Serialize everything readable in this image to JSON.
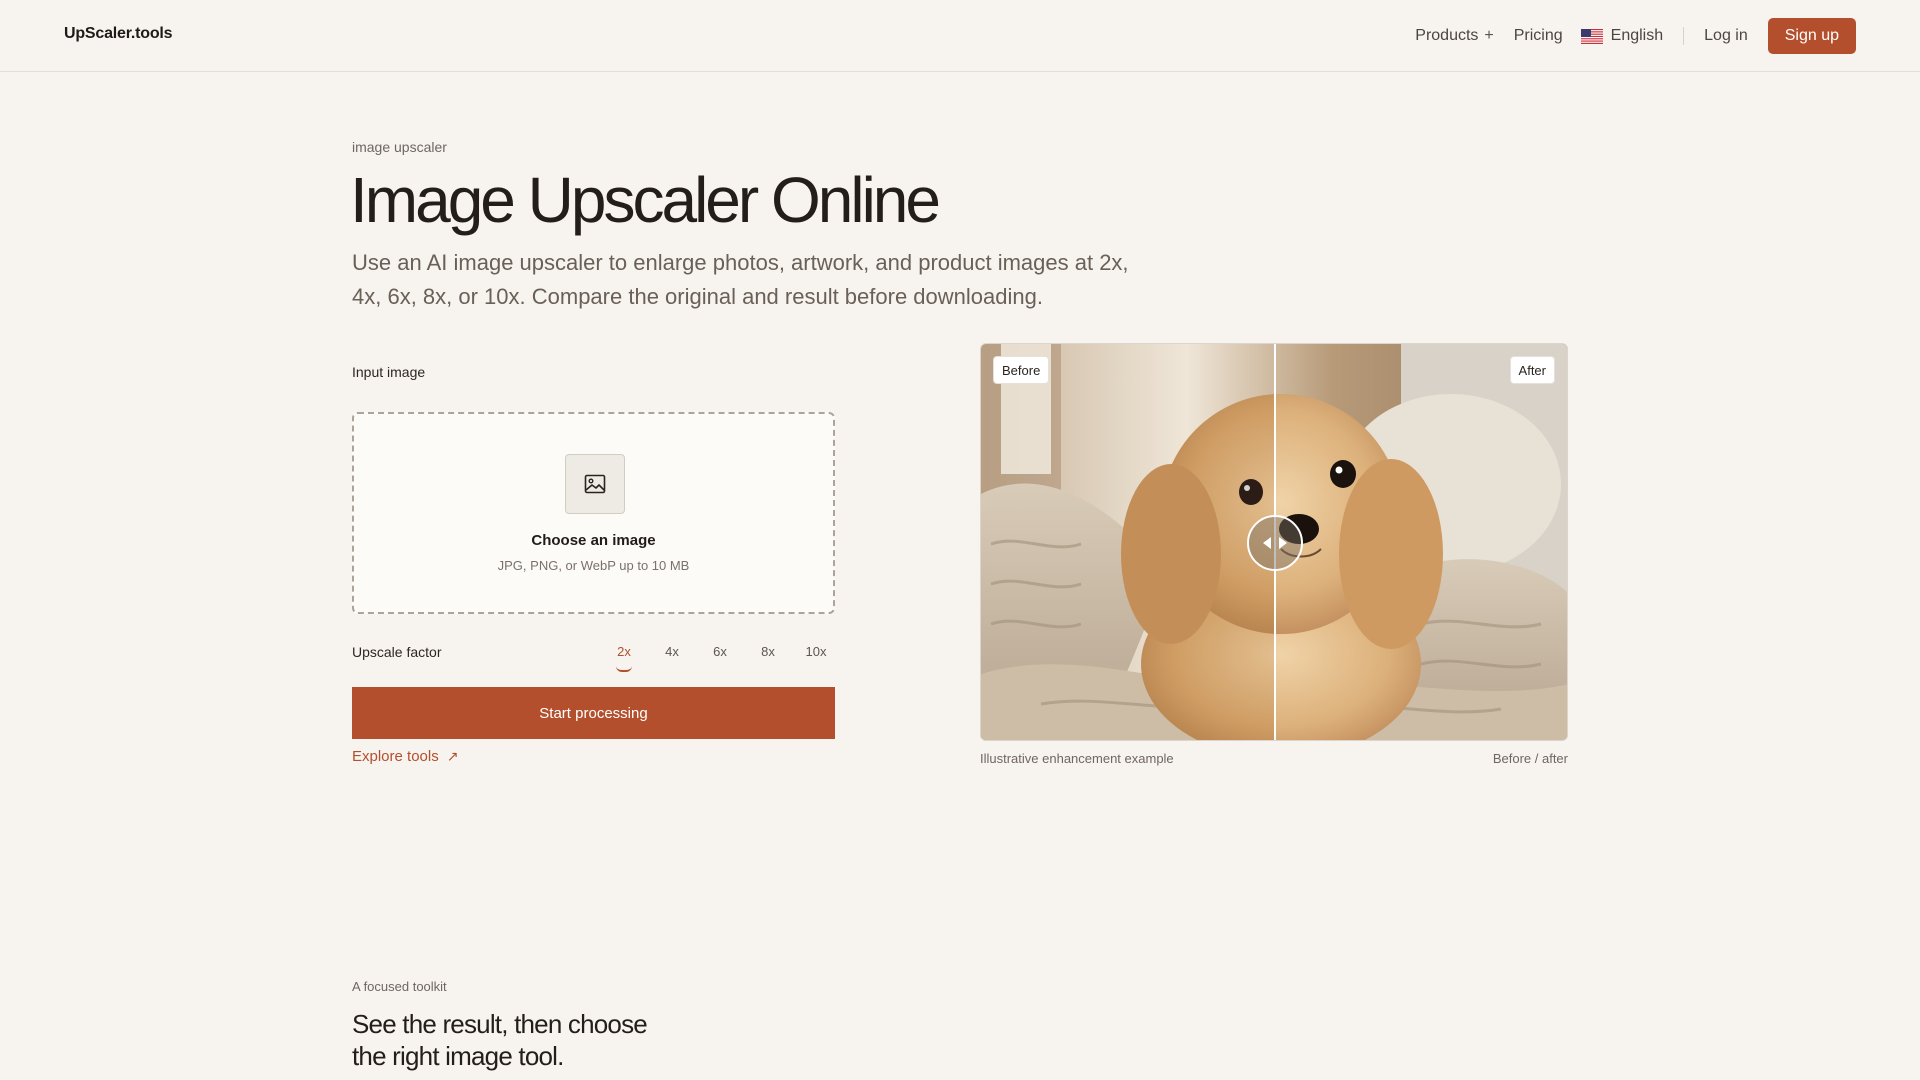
{
  "header": {
    "brand": "UpScaler.tools",
    "nav": {
      "products": "Products",
      "pricing": "Pricing",
      "language": "English",
      "login": "Log in",
      "signup": "Sign up"
    }
  },
  "hero": {
    "eyebrow": "image upscaler",
    "title": "Image Upscaler Online",
    "description": "Use an AI image upscaler to enlarge photos, artwork, and product images at 2x, 4x, 6x, 8x, or 10x. Compare the original and result before downloading."
  },
  "upload": {
    "input_label": "Input image",
    "dropzone_title": "Choose an image",
    "dropzone_hint": "JPG, PNG, or WebP up to 10 MB",
    "factor_label": "Upscale factor",
    "factors": [
      "2x",
      "4x",
      "6x",
      "8x",
      "10x"
    ],
    "selected_factor": "2x",
    "start_label": "Start processing",
    "explore_label": "Explore tools"
  },
  "comparison": {
    "before_label": "Before",
    "after_label": "After",
    "caption": "Illustrative enhancement example",
    "caption_right": "Before / after",
    "slider_fraction": 0.5
  },
  "section": {
    "eyebrow": "A focused toolkit",
    "title": "See the result, then choose the right image tool."
  },
  "icons": {
    "products": "plus-icon",
    "language": "us-flag-icon",
    "dropzone": "image-icon",
    "explore": "arrow-up-right-icon",
    "slider": "left-right-arrows-icon"
  },
  "colors": {
    "accent": "#b44f2d",
    "background": "#f7f4f0"
  }
}
